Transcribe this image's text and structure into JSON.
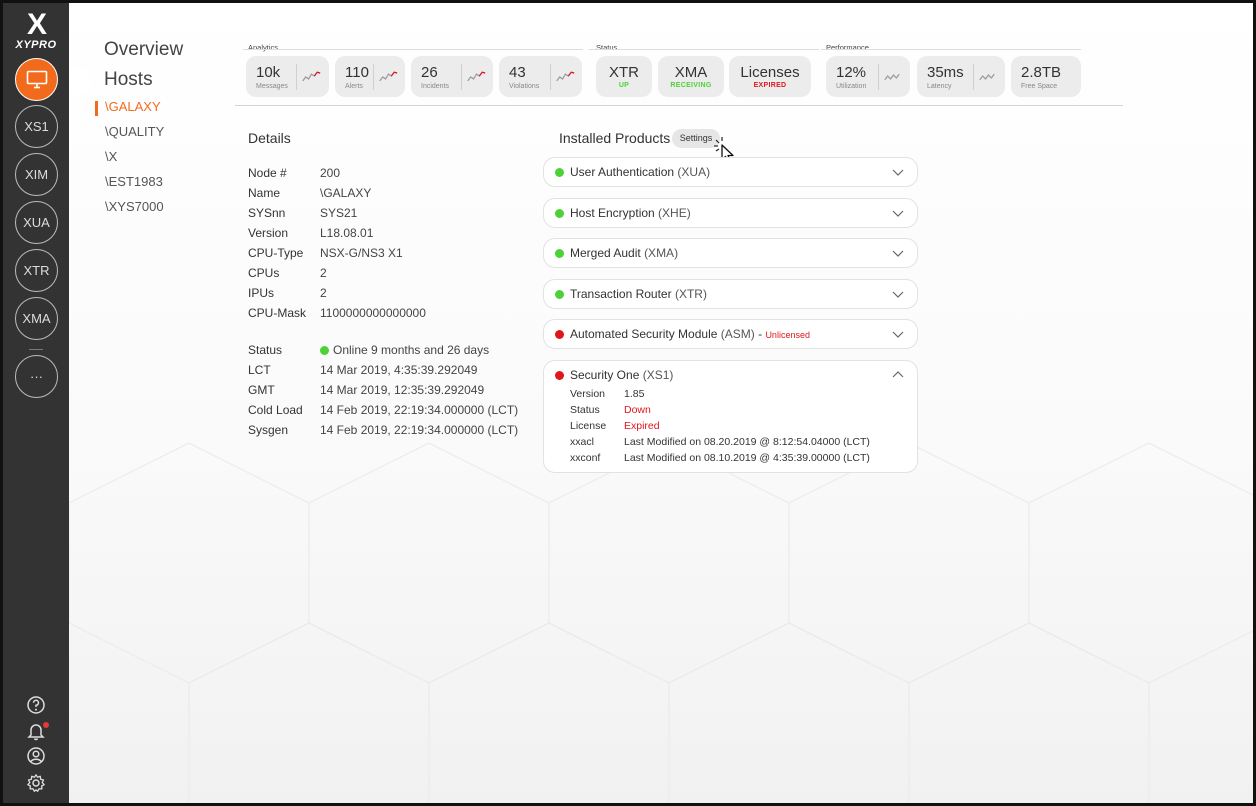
{
  "brand": {
    "logo_mark": "X",
    "name": "XYPRO"
  },
  "sidebar": {
    "items": [
      {
        "id": "monitor",
        "icon": "monitor-icon",
        "label": "",
        "active": true
      },
      {
        "id": "xs1",
        "label": "XS1"
      },
      {
        "id": "xim",
        "label": "XIM"
      },
      {
        "id": "xua",
        "label": "XUA"
      },
      {
        "id": "xtr",
        "label": "XTR"
      },
      {
        "id": "xma",
        "label": "XMA"
      },
      {
        "id": "more",
        "label": "···"
      }
    ],
    "bottom_icons": [
      "help-icon",
      "bell-icon",
      "user-icon",
      "gear-icon"
    ]
  },
  "hostnav": {
    "overview": "Overview",
    "hosts": "Hosts",
    "items": [
      "\\GALAXY",
      "\\QUALITY",
      "\\X",
      "\\EST1983",
      "\\XYS7000"
    ],
    "active_index": 0
  },
  "metrics": {
    "analytics_label": "Analytics",
    "status_label": "Status",
    "performance_label": "Performance",
    "analytics": [
      {
        "value": "10k",
        "label": "Messages"
      },
      {
        "value": "110",
        "label": "Alerts"
      },
      {
        "value": "26",
        "label": "Incidents"
      },
      {
        "value": "43",
        "label": "Violations"
      }
    ],
    "status": [
      {
        "value": "XTR",
        "state": "UP",
        "color": "#4cd137"
      },
      {
        "value": "XMA",
        "state": "RECEIVING",
        "color": "#4cd137"
      },
      {
        "value": "Licenses",
        "state": "EXPIRED",
        "color": "#e0161d"
      }
    ],
    "performance": [
      {
        "value": "12%",
        "label": "Utilization"
      },
      {
        "value": "35ms",
        "label": "Latency"
      },
      {
        "value": "2.8TB",
        "label": "Free Space"
      }
    ]
  },
  "details": {
    "title": "Details",
    "rows": [
      {
        "k": "Node #",
        "v": "200"
      },
      {
        "k": "Name",
        "v": "\\GALAXY"
      },
      {
        "k": "SYSnn",
        "v": "SYS21"
      },
      {
        "k": "Version",
        "v": "L18.08.01"
      },
      {
        "k": "CPU-Type",
        "v": "NSX-G/NS3 X1"
      },
      {
        "k": "CPUs",
        "v": "2"
      },
      {
        "k": "IPUs",
        "v": "2"
      },
      {
        "k": "CPU-Mask",
        "v": "1100000000000000"
      }
    ],
    "rows2": [
      {
        "k": "Status",
        "v": "Online 9 months and 26 days"
      },
      {
        "k": "LCT",
        "v": "14 Mar 2019, 4:35:39.292049"
      },
      {
        "k": "GMT",
        "v": "14 Mar 2019, 12:35:39.292049"
      },
      {
        "k": "Cold Load",
        "v": "14 Feb 2019, 22:19:34.000000 (LCT)"
      },
      {
        "k": "Sysgen",
        "v": "14 Feb 2019, 22:19:34.000000 (LCT)"
      }
    ]
  },
  "products": {
    "title": "Installed Products",
    "settings_label": "Settings",
    "items": [
      {
        "name": "User Authentication",
        "code": "(XUA)",
        "status": "green"
      },
      {
        "name": "Host Encryption",
        "code": "(XHE)",
        "status": "green"
      },
      {
        "name": "Merged Audit",
        "code": "(XMA)",
        "status": "green"
      },
      {
        "name": "Transaction Router",
        "code": "(XTR)",
        "status": "green"
      },
      {
        "name": "Automated Security Module",
        "code": "(ASM)",
        "status": "red",
        "suffix": " - ",
        "note": "Unlicensed"
      }
    ],
    "expanded": {
      "name": "Security One",
      "code": "(XS1)",
      "status": "red",
      "rows": [
        {
          "k": "Version",
          "v": "1.85"
        },
        {
          "k": "Status",
          "v": "Down"
        },
        {
          "k": "License",
          "v": "Expired"
        },
        {
          "k": "xxacl",
          "v": "Last Modified on 08.20.2019 @ 8:12:54.04000 (LCT)"
        },
        {
          "k": "xxconf",
          "v": "Last Modified on 08.10.2019 @ 4:35:39.00000 (LCT)"
        }
      ]
    }
  },
  "colors": {
    "accent": "#f26b1d",
    "ok": "#4cd137",
    "error": "#e0161d",
    "sidebar": "#333333"
  }
}
